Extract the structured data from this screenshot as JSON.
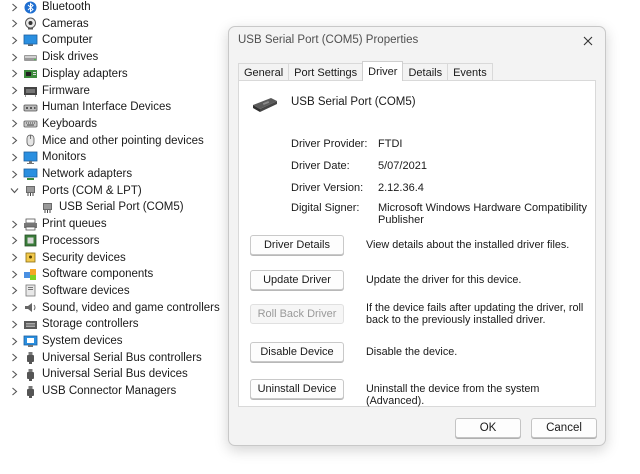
{
  "tree": {
    "items": [
      {
        "label": "Bluetooth",
        "icon": "bluetooth-icon",
        "expanded": false
      },
      {
        "label": "Cameras",
        "icon": "camera-icon",
        "expanded": false
      },
      {
        "label": "Computer",
        "icon": "computer-icon",
        "expanded": false
      },
      {
        "label": "Disk drives",
        "icon": "disk-drive-icon",
        "expanded": false
      },
      {
        "label": "Display adapters",
        "icon": "display-adapter-icon",
        "expanded": false
      },
      {
        "label": "Firmware",
        "icon": "firmware-icon",
        "expanded": false
      },
      {
        "label": "Human Interface Devices",
        "icon": "hid-icon",
        "expanded": false
      },
      {
        "label": "Keyboards",
        "icon": "keyboard-icon",
        "expanded": false
      },
      {
        "label": "Mice and other pointing devices",
        "icon": "mouse-icon",
        "expanded": false
      },
      {
        "label": "Monitors",
        "icon": "monitor-icon",
        "expanded": false
      },
      {
        "label": "Network adapters",
        "icon": "network-adapter-icon",
        "expanded": false
      },
      {
        "label": "Ports (COM & LPT)",
        "icon": "port-icon",
        "expanded": true
      },
      {
        "label": "USB Serial Port (COM5)",
        "icon": "port-icon",
        "child": true
      },
      {
        "label": "Print queues",
        "icon": "printer-icon",
        "expanded": false
      },
      {
        "label": "Processors",
        "icon": "processor-icon",
        "expanded": false
      },
      {
        "label": "Security devices",
        "icon": "security-device-icon",
        "expanded": false
      },
      {
        "label": "Software components",
        "icon": "software-component-icon",
        "expanded": false
      },
      {
        "label": "Software devices",
        "icon": "software-device-icon",
        "expanded": false
      },
      {
        "label": "Sound, video and game controllers",
        "icon": "speaker-icon",
        "expanded": false
      },
      {
        "label": "Storage controllers",
        "icon": "storage-controller-icon",
        "expanded": false
      },
      {
        "label": "System devices",
        "icon": "system-device-icon",
        "expanded": false
      },
      {
        "label": "Universal Serial Bus controllers",
        "icon": "usb-icon",
        "expanded": false
      },
      {
        "label": "Universal Serial Bus devices",
        "icon": "usb-icon",
        "expanded": false
      },
      {
        "label": "USB Connector Managers",
        "icon": "usb-icon",
        "expanded": false
      }
    ]
  },
  "dialog": {
    "title": "USB Serial Port (COM5) Properties",
    "tabs": [
      "General",
      "Port Settings",
      "Driver",
      "Details",
      "Events"
    ],
    "active_tab": "Driver",
    "device_name": "USB Serial Port (COM5)",
    "info": {
      "provider_label": "Driver Provider:",
      "provider_value": "FTDI",
      "date_label": "Driver Date:",
      "date_value": "5/07/2021",
      "version_label": "Driver Version:",
      "version_value": "2.12.36.4",
      "signer_label": "Digital Signer:",
      "signer_value": "Microsoft Windows Hardware Compatibility Publisher"
    },
    "actions": [
      {
        "button": "Driver Details",
        "description": "View details about the installed driver files.",
        "enabled": true
      },
      {
        "button": "Update Driver",
        "description": "Update the driver for this device.",
        "enabled": true
      },
      {
        "button": "Roll Back Driver",
        "description": "If the device fails after updating the driver, roll back to the previously installed driver.",
        "enabled": false
      },
      {
        "button": "Disable Device",
        "description": "Disable the device.",
        "enabled": true
      },
      {
        "button": "Uninstall Device",
        "description": "Uninstall the device from the system (Advanced).",
        "enabled": true
      }
    ],
    "ok_label": "OK",
    "cancel_label": "Cancel"
  }
}
